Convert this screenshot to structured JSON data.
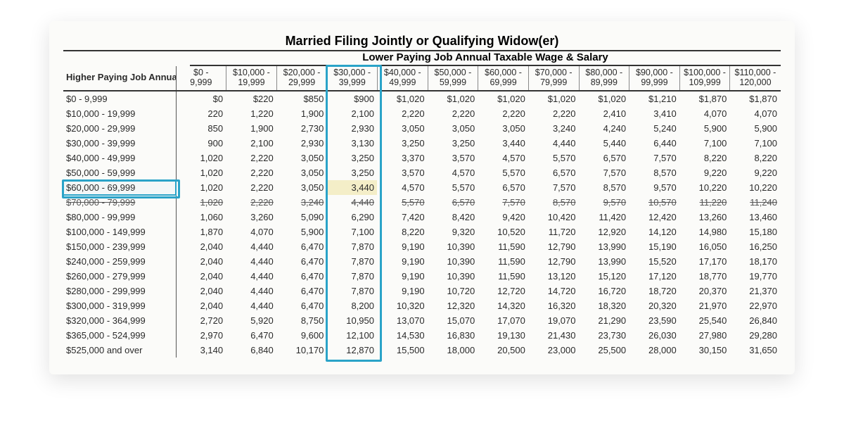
{
  "title": "Married Filing Jointly or Qualifying Widow(er)",
  "subtitle": "Lower Paying Job Annual Taxable Wage & Salary",
  "row_header_label": "Higher Paying Job Annual Taxable Wage & Salary",
  "columns": [
    {
      "top": "$0 -",
      "bot": "9,999"
    },
    {
      "top": "$10,000 -",
      "bot": "19,999"
    },
    {
      "top": "$20,000 -",
      "bot": "29,999"
    },
    {
      "top": "$30,000 -",
      "bot": "39,999"
    },
    {
      "top": "$40,000 -",
      "bot": "49,999"
    },
    {
      "top": "$50,000 -",
      "bot": "59,999"
    },
    {
      "top": "$60,000 -",
      "bot": "69,999"
    },
    {
      "top": "$70,000 -",
      "bot": "79,999"
    },
    {
      "top": "$80,000 -",
      "bot": "89,999"
    },
    {
      "top": "$90,000 -",
      "bot": "99,999"
    },
    {
      "top": "$100,000 -",
      "bot": "109,999"
    },
    {
      "top": "$110,000 -",
      "bot": "120,000"
    }
  ],
  "rows": [
    {
      "label": "$0 -   9,999",
      "v": [
        "$0",
        "$220",
        "$850",
        "$900",
        "$1,020",
        "$1,020",
        "$1,020",
        "$1,020",
        "$1,020",
        "$1,210",
        "$1,870",
        "$1,870"
      ]
    },
    {
      "label": "$10,000 -  19,999",
      "v": [
        "220",
        "1,220",
        "1,900",
        "2,100",
        "2,220",
        "2,220",
        "2,220",
        "2,220",
        "2,410",
        "3,410",
        "4,070",
        "4,070"
      ]
    },
    {
      "label": "$20,000 -  29,999",
      "v": [
        "850",
        "1,900",
        "2,730",
        "2,930",
        "3,050",
        "3,050",
        "3,050",
        "3,240",
        "4,240",
        "5,240",
        "5,900",
        "5,900"
      ]
    },
    {
      "label": "$30,000 -  39,999",
      "v": [
        "900",
        "2,100",
        "2,930",
        "3,130",
        "3,250",
        "3,250",
        "3,440",
        "4,440",
        "5,440",
        "6,440",
        "7,100",
        "7,100"
      ]
    },
    {
      "label": "$40,000 -  49,999",
      "v": [
        "1,020",
        "2,220",
        "3,050",
        "3,250",
        "3,370",
        "3,570",
        "4,570",
        "5,570",
        "6,570",
        "7,570",
        "8,220",
        "8,220"
      ]
    },
    {
      "label": "$50,000 -  59,999",
      "v": [
        "1,020",
        "2,220",
        "3,050",
        "3,250",
        "3,570",
        "4,570",
        "5,570",
        "6,570",
        "7,570",
        "8,570",
        "9,220",
        "9,220"
      ]
    },
    {
      "label": "$60,000 -  69,999",
      "v": [
        "1,020",
        "2,220",
        "3,050",
        "3,440",
        "4,570",
        "5,570",
        "6,570",
        "7,570",
        "8,570",
        "9,570",
        "10,220",
        "10,220"
      ],
      "hl_row": true,
      "hl_cell_col": 3
    },
    {
      "label": "$70,000 -  79,999",
      "v": [
        "1,020",
        "2,220",
        "3,240",
        "4,440",
        "5,570",
        "6,570",
        "7,570",
        "8,570",
        "9,570",
        "10,570",
        "11,220",
        "11,240"
      ],
      "struck": true
    },
    {
      "label": "$80,000 -  99,999",
      "v": [
        "1,060",
        "3,260",
        "5,090",
        "6,290",
        "7,420",
        "8,420",
        "9,420",
        "10,420",
        "11,420",
        "12,420",
        "13,260",
        "13,460"
      ]
    },
    {
      "label": "$100,000 - 149,999",
      "v": [
        "1,870",
        "4,070",
        "5,900",
        "7,100",
        "8,220",
        "9,320",
        "10,520",
        "11,720",
        "12,920",
        "14,120",
        "14,980",
        "15,180"
      ]
    },
    {
      "label": "$150,000 - 239,999",
      "v": [
        "2,040",
        "4,440",
        "6,470",
        "7,870",
        "9,190",
        "10,390",
        "11,590",
        "12,790",
        "13,990",
        "15,190",
        "16,050",
        "16,250"
      ]
    },
    {
      "label": "$240,000 - 259,999",
      "v": [
        "2,040",
        "4,440",
        "6,470",
        "7,870",
        "9,190",
        "10,390",
        "11,590",
        "12,790",
        "13,990",
        "15,520",
        "17,170",
        "18,170"
      ]
    },
    {
      "label": "$260,000 - 279,999",
      "v": [
        "2,040",
        "4,440",
        "6,470",
        "7,870",
        "9,190",
        "10,390",
        "11,590",
        "13,120",
        "15,120",
        "17,120",
        "18,770",
        "19,770"
      ]
    },
    {
      "label": "$280,000 - 299,999",
      "v": [
        "2,040",
        "4,440",
        "6,470",
        "7,870",
        "9,190",
        "10,720",
        "12,720",
        "14,720",
        "16,720",
        "18,720",
        "20,370",
        "21,370"
      ]
    },
    {
      "label": "$300,000 - 319,999",
      "v": [
        "2,040",
        "4,440",
        "6,470",
        "8,200",
        "10,320",
        "12,320",
        "14,320",
        "16,320",
        "18,320",
        "20,320",
        "21,970",
        "22,970"
      ]
    },
    {
      "label": "$320,000 - 364,999",
      "v": [
        "2,720",
        "5,920",
        "8,750",
        "10,950",
        "13,070",
        "15,070",
        "17,070",
        "19,070",
        "21,290",
        "23,590",
        "25,540",
        "26,840"
      ]
    },
    {
      "label": "$365,000 - 524,999",
      "v": [
        "2,970",
        "6,470",
        "9,600",
        "12,100",
        "14,530",
        "16,830",
        "19,130",
        "21,430",
        "23,730",
        "26,030",
        "27,980",
        "29,280"
      ]
    },
    {
      "label": "$525,000 and over",
      "v": [
        "3,140",
        "6,840",
        "10,170",
        "12,870",
        "15,500",
        "18,000",
        "20,500",
        "23,000",
        "25,500",
        "28,000",
        "30,150",
        "31,650"
      ]
    }
  ],
  "highlights": {
    "column_index": 3,
    "row_index": 6,
    "colors": {
      "outline": "#2AA3C8",
      "cell_fill": "#F4EEC8"
    }
  }
}
